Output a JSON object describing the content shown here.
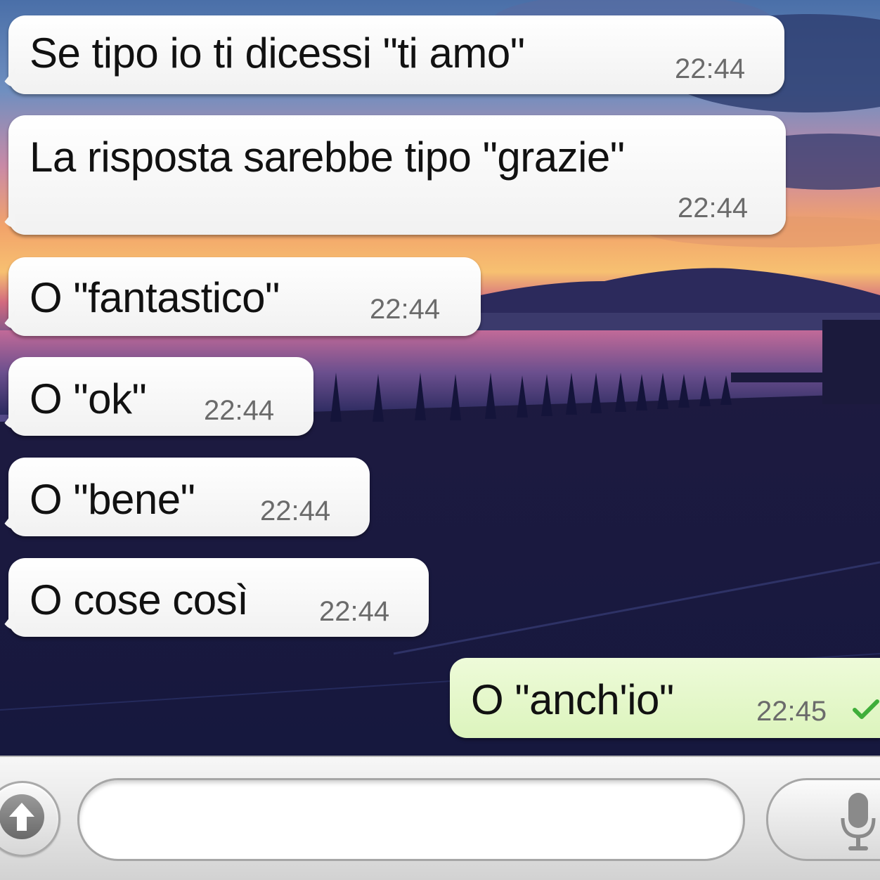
{
  "conversation": {
    "messages": [
      {
        "direction": "incoming",
        "text": "Se tipo io ti dicessi \"ti amo\"",
        "time": "22:44"
      },
      {
        "direction": "incoming",
        "text": "La risposta sarebbe tipo \"grazie\"",
        "time": "22:44"
      },
      {
        "direction": "incoming",
        "text": "O \"fantastico\"",
        "time": "22:44"
      },
      {
        "direction": "incoming",
        "text": "O \"ok\"",
        "time": "22:44"
      },
      {
        "direction": "incoming",
        "text": "O \"bene\"",
        "time": "22:44"
      },
      {
        "direction": "incoming",
        "text": "O cose così",
        "time": "22:44"
      },
      {
        "direction": "outgoing",
        "text": "O \"anch'io\"",
        "time": "22:45",
        "status_icon": "sent-check-icon"
      }
    ]
  },
  "composer": {
    "input_value": "",
    "attach_icon": "upload-arrow-icon",
    "mic_icon": "microphone-icon"
  },
  "colors": {
    "incoming_bubble": "#ffffff",
    "outgoing_bubble": "#dcf4bd",
    "check_green": "#3fae3a",
    "timestamp": "#6b6b6b"
  }
}
